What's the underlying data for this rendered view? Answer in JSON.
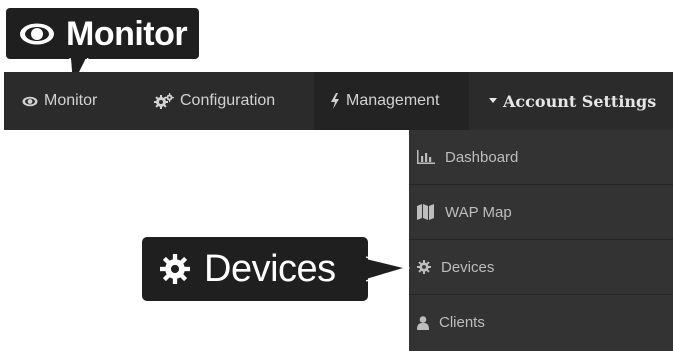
{
  "callouts": {
    "monitor_label": "Monitor",
    "devices_label": "Devices"
  },
  "navbar": {
    "items": [
      {
        "label": "Monitor",
        "icon": "eye-icon"
      },
      {
        "label": "Configuration",
        "icon": "gears-icon"
      },
      {
        "label": "Management",
        "icon": "bolt-icon",
        "active": true
      },
      {
        "label": "Account Settings",
        "icon": "caret-down-icon"
      }
    ]
  },
  "dropdown": {
    "items": [
      {
        "label": "Dashboard",
        "icon": "bar-chart-icon"
      },
      {
        "label": "WAP Map",
        "icon": "map-icon"
      },
      {
        "label": "Devices",
        "icon": "gear-icon"
      },
      {
        "label": "Clients",
        "icon": "user-icon"
      }
    ]
  },
  "colors": {
    "navbar_bg": "#2b2b2b",
    "active_bg": "#232323",
    "dropdown_bg": "#333333",
    "callout_bg": "#1f1f1f",
    "text_light": "#d2d2d2"
  }
}
